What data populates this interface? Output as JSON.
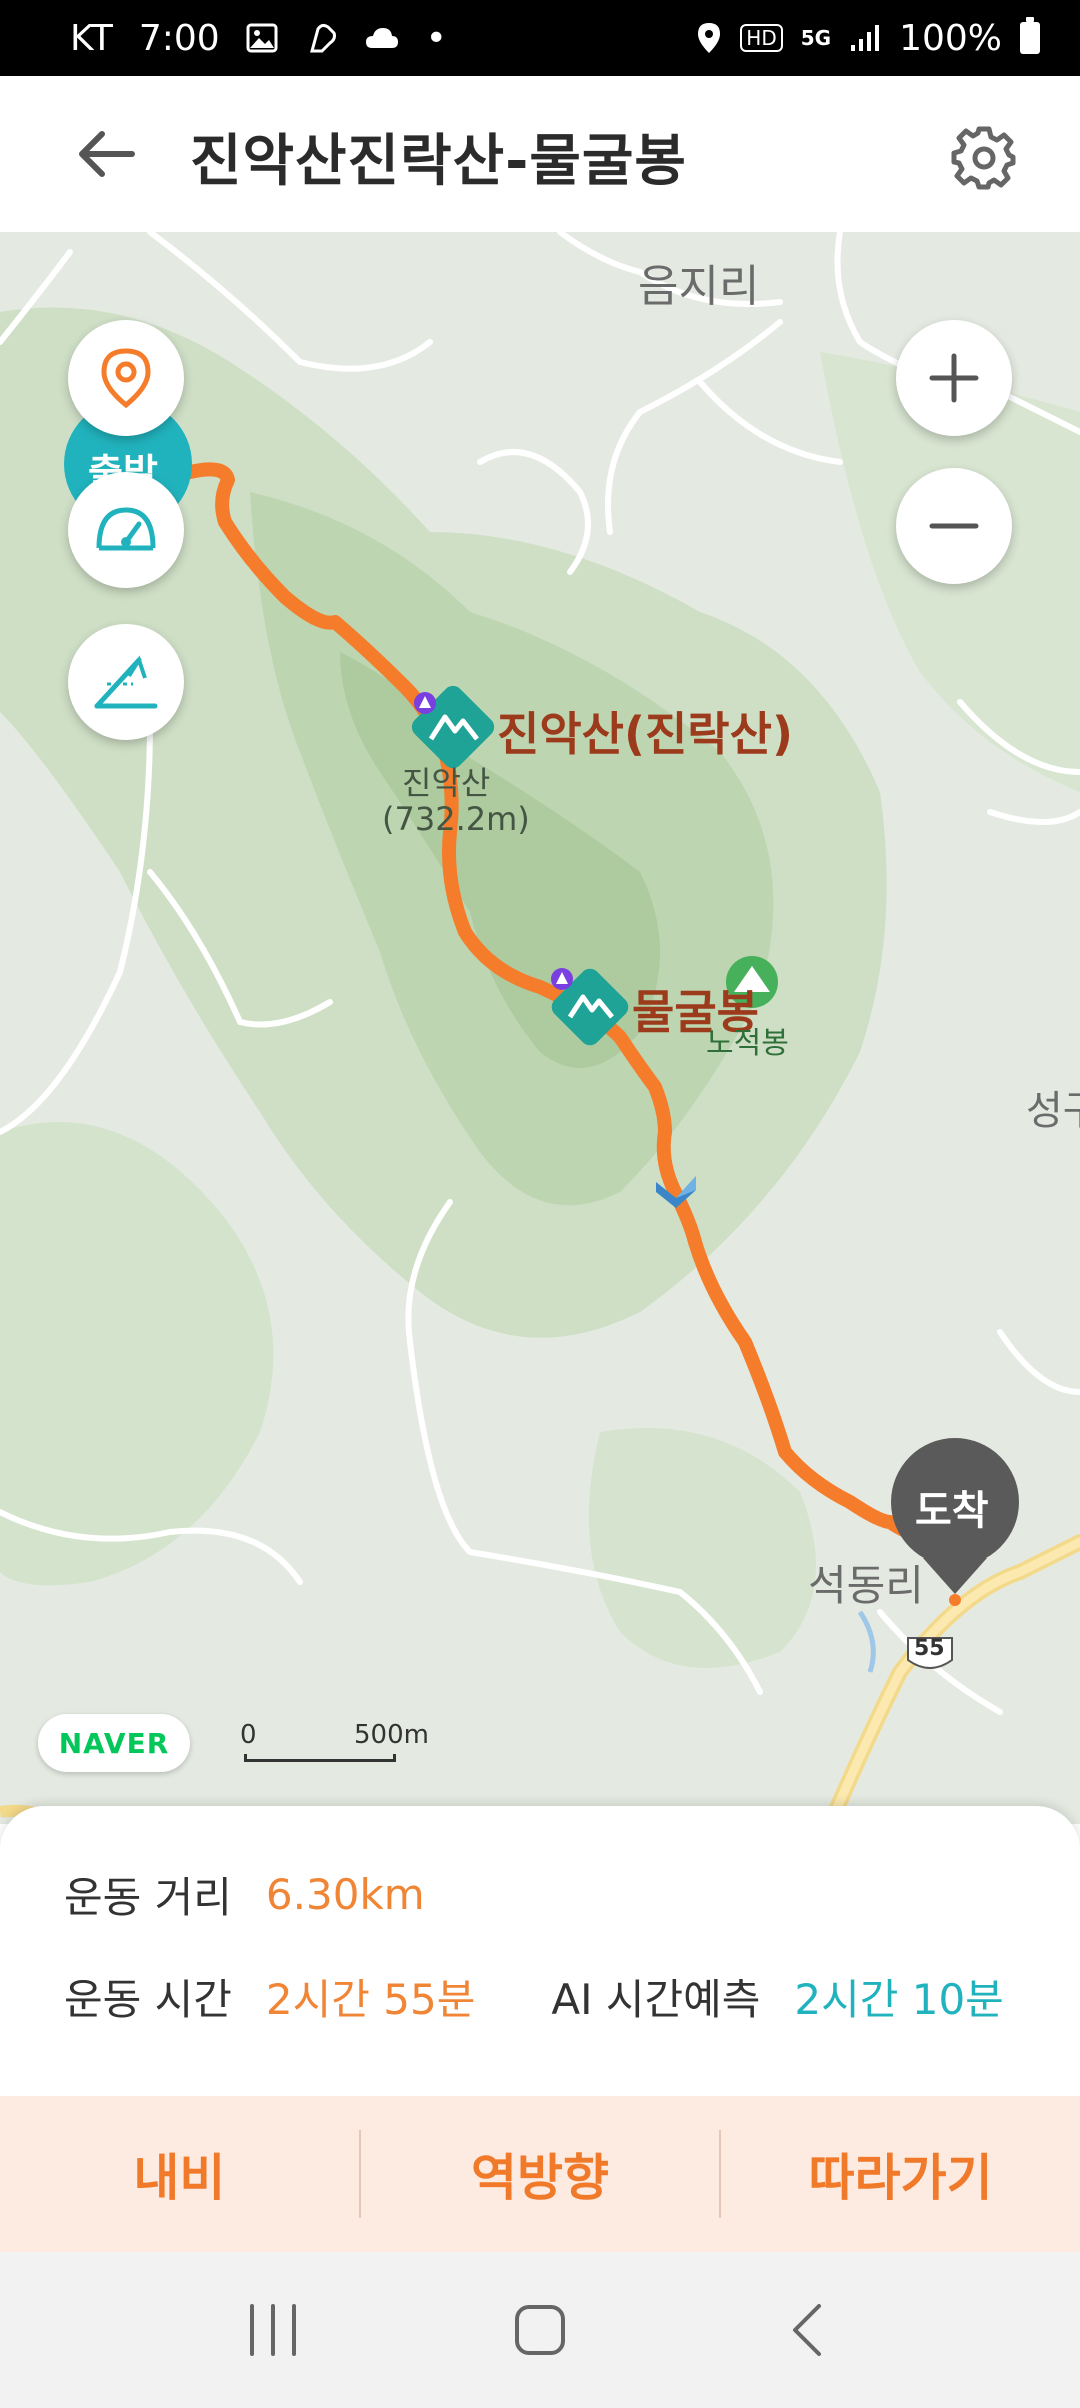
{
  "status_bar": {
    "carrier": "KT",
    "time": "7:00",
    "dot": "•",
    "hd": "HD",
    "network": "5G",
    "battery": "100%"
  },
  "header": {
    "title": "진악산진락산-물굴봉"
  },
  "map": {
    "places": {
      "village_top": "음지리",
      "peak1_label": "진악산(진락산)",
      "peak1_sub1": "진악산",
      "peak1_sub2": "(732.2m)",
      "peak2_label": "물굴봉",
      "peak3": "노적봉",
      "village_bottom": "석동리",
      "village_right": "성구"
    },
    "start_label": "출발",
    "end_label": "도착",
    "road_number": "55",
    "scale_zero": "0",
    "scale_distance": "500m",
    "provider": "NAVER",
    "colors": {
      "route": "#f57c2b",
      "accent": "#21b3bd",
      "forest": "#c9dcc0"
    }
  },
  "stats": {
    "distance_label": "운동 거리",
    "distance_value": "6.30km",
    "time_label": "운동 시간",
    "time_value": "2시간 55분",
    "ai_label": "AI 시간예측",
    "ai_value": "2시간 10분"
  },
  "actions": {
    "navigate": "내비",
    "reverse": "역방향",
    "follow": "따라가기"
  }
}
